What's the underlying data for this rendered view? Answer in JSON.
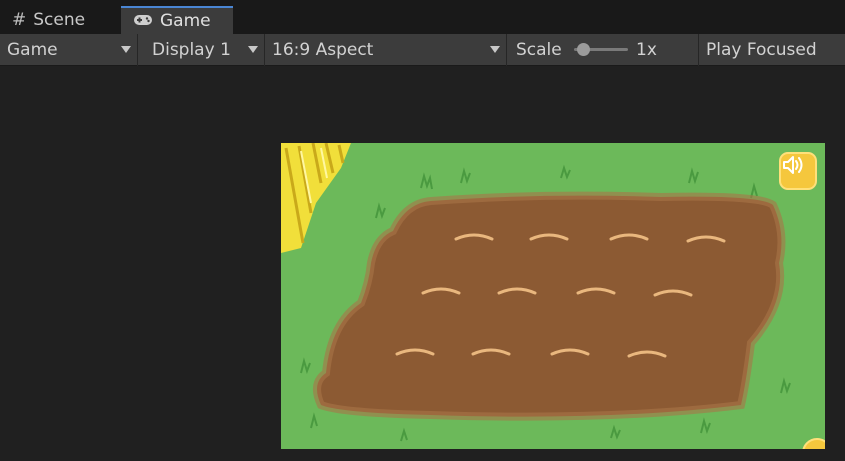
{
  "tabs": {
    "scene": {
      "label": "Scene",
      "icon": "hash-icon"
    },
    "game": {
      "label": "Game",
      "icon": "gamepad-icon",
      "active": true
    }
  },
  "toolbar": {
    "view_select": "Game",
    "display_select": "Display 1",
    "aspect_select": "16:9 Aspect",
    "scale_label": "Scale",
    "scale_value": "1x",
    "scale_fraction": 0.0,
    "play_mode": "Play Focused"
  },
  "game_view": {
    "field": {
      "rows": 3,
      "furrows_per_row": 4
    },
    "colors": {
      "grass": "#6cb95a",
      "soil": "#8c5a33",
      "furrow": "#e9b77e",
      "button": "#f5c73d"
    },
    "sound_button_icon": "speaker-icon"
  }
}
